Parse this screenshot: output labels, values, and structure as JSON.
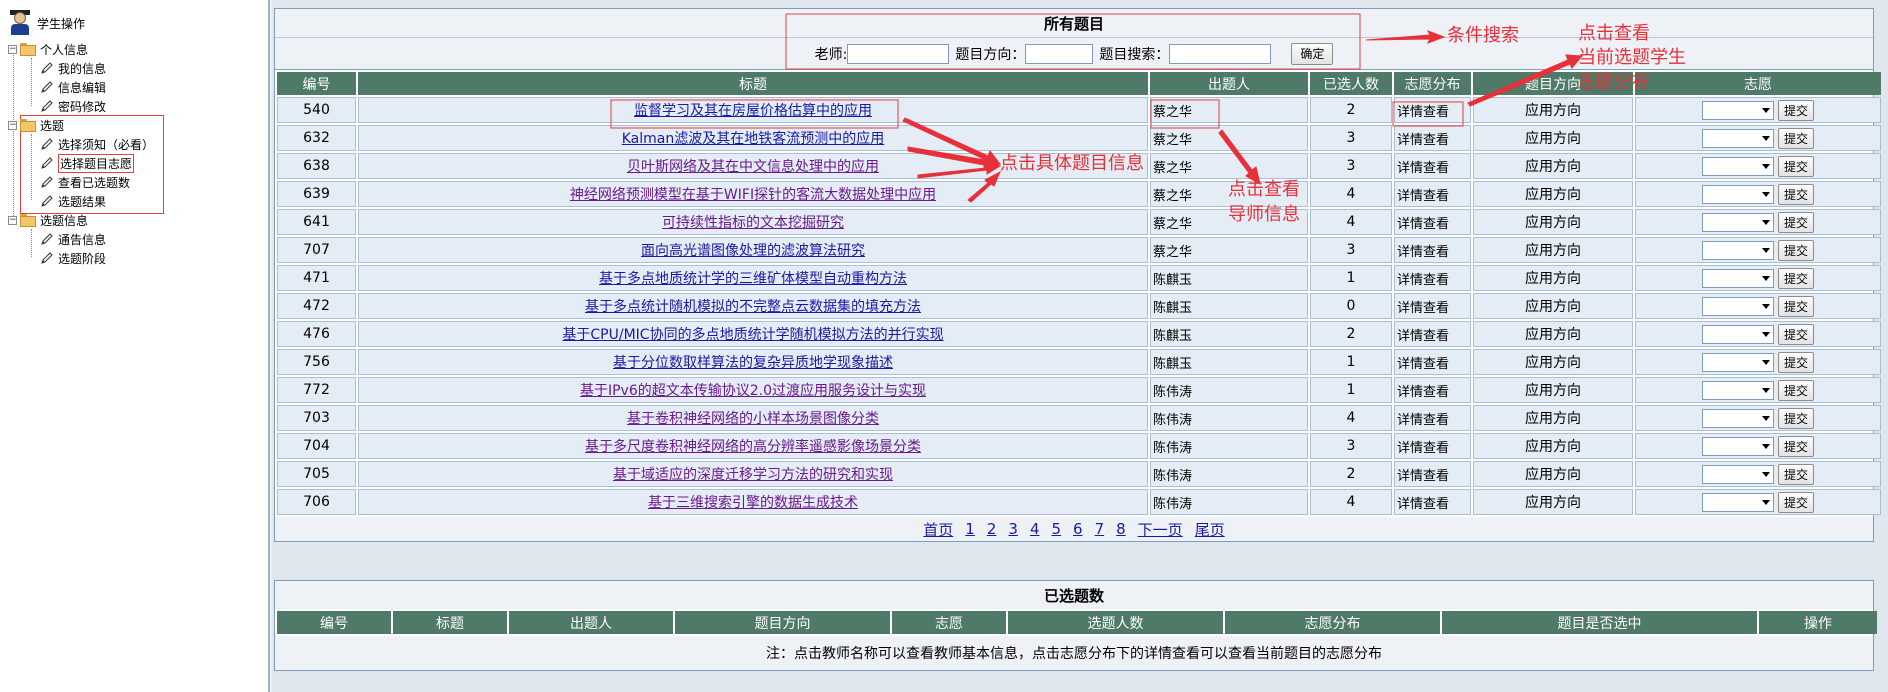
{
  "sidebar": {
    "root_label": "学生操作",
    "groups": [
      {
        "label": "个人信息",
        "items": [
          "我的信息",
          "信息编辑",
          "密码修改"
        ]
      },
      {
        "label": "选题",
        "items": [
          "选择须知（必看）",
          "选择题目志愿",
          "查看已选题数",
          "选题结果"
        ]
      },
      {
        "label": "选题信息",
        "items": [
          "通告信息",
          "选题阶段"
        ]
      }
    ]
  },
  "topics_panel": {
    "title": "所有题目",
    "search": {
      "teacher_label": "老师:",
      "direction_label": "题目方向：",
      "keyword_label": "题目搜索：",
      "teacher_value": "",
      "direction_value": "",
      "keyword_value": "",
      "confirm_label": "确定"
    },
    "columns": [
      "编号",
      "标题",
      "出题人",
      "已选人数",
      "志愿分布",
      "题目方向",
      "志愿"
    ],
    "rows": [
      {
        "id": "540",
        "title": "监督学习及其在房屋价格估算中的应用",
        "teacher": "蔡之华",
        "count": "2",
        "detail": "详情查看",
        "direction": "应用方向",
        "visited": false
      },
      {
        "id": "632",
        "title": "Kalman滤波及其在地铁客流预测中的应用",
        "teacher": "蔡之华",
        "count": "3",
        "detail": "详情查看",
        "direction": "应用方向",
        "visited": false
      },
      {
        "id": "638",
        "title": "贝叶斯网络及其在中文信息处理中的应用",
        "teacher": "蔡之华",
        "count": "3",
        "detail": "详情查看",
        "direction": "应用方向",
        "visited": true
      },
      {
        "id": "639",
        "title": "神经网络预测模型在基于WIFI探针的客流大数据处理中应用",
        "teacher": "蔡之华",
        "count": "4",
        "detail": "详情查看",
        "direction": "应用方向",
        "visited": true
      },
      {
        "id": "641",
        "title": "可持续性指标的文本挖掘研究",
        "teacher": "蔡之华",
        "count": "4",
        "detail": "详情查看",
        "direction": "应用方向",
        "visited": true
      },
      {
        "id": "707",
        "title": "面向高光谱图像处理的滤波算法研究",
        "teacher": "蔡之华",
        "count": "3",
        "detail": "详情查看",
        "direction": "应用方向",
        "visited": false
      },
      {
        "id": "471",
        "title": "基于多点地质统计学的三维矿体模型自动重构方法",
        "teacher": "陈麒玉",
        "count": "1",
        "detail": "详情查看",
        "direction": "应用方向",
        "visited": false
      },
      {
        "id": "472",
        "title": "基于多点统计随机模拟的不完整点云数据集的填充方法",
        "teacher": "陈麒玉",
        "count": "0",
        "detail": "详情查看",
        "direction": "应用方向",
        "visited": false
      },
      {
        "id": "476",
        "title": "基于CPU/MIC协同的多点地质统计学随机模拟方法的并行实现",
        "teacher": "陈麒玉",
        "count": "2",
        "detail": "详情查看",
        "direction": "应用方向",
        "visited": false
      },
      {
        "id": "756",
        "title": "基于分位数取样算法的复杂异质地学现象描述",
        "teacher": "陈麒玉",
        "count": "1",
        "detail": "详情查看",
        "direction": "应用方向",
        "visited": false
      },
      {
        "id": "772",
        "title": "基于IPv6的超文本传输协议2.0过渡应用服务设计与实现",
        "teacher": "陈伟涛",
        "count": "1",
        "detail": "详情查看",
        "direction": "应用方向",
        "visited": true
      },
      {
        "id": "703",
        "title": "基于卷积神经网络的小样本场景图像分类",
        "teacher": "陈伟涛",
        "count": "4",
        "detail": "详情查看",
        "direction": "应用方向",
        "visited": true
      },
      {
        "id": "704",
        "title": "基于多尺度卷积神经网络的高分辨率遥感影像场景分类",
        "teacher": "陈伟涛",
        "count": "3",
        "detail": "详情查看",
        "direction": "应用方向",
        "visited": true
      },
      {
        "id": "705",
        "title": "基于域适应的深度迁移学习方法的研究和实现",
        "teacher": "陈伟涛",
        "count": "2",
        "detail": "详情查看",
        "direction": "应用方向",
        "visited": true
      },
      {
        "id": "706",
        "title": "基于三维搜索引擎的数据生成技术",
        "teacher": "陈伟涛",
        "count": "4",
        "detail": "详情查看",
        "direction": "应用方向",
        "visited": true
      }
    ],
    "submit_label": "提交",
    "pager": [
      "首页",
      "1",
      "2",
      "3",
      "4",
      "5",
      "6",
      "7",
      "8",
      "下一页",
      "尾页"
    ]
  },
  "selected_panel": {
    "title": "已选题数",
    "columns": [
      "编号",
      "标题",
      "出题人",
      "题目方向",
      "志愿",
      "选题人数",
      "志愿分布",
      "题目是否选中",
      "操作"
    ],
    "note": "注：点击教师名称可以查看教师基本信息，点击志愿分布下的详情查看可以查看当前题目的志愿分布"
  },
  "annotations": {
    "search": "条件搜索",
    "view_students_1": "点击查看",
    "view_students_2": "当前选题学生",
    "view_students_3": "志愿分布",
    "topic_info": "点击具体题目信息",
    "teacher_info_1": "点击查看",
    "teacher_info_2": "导师信息"
  },
  "colors": {
    "header_bg": "#4e7a67",
    "annotation": "#e8303a",
    "link": "#1a1aa6",
    "visited_link": "#6a1a8e"
  }
}
